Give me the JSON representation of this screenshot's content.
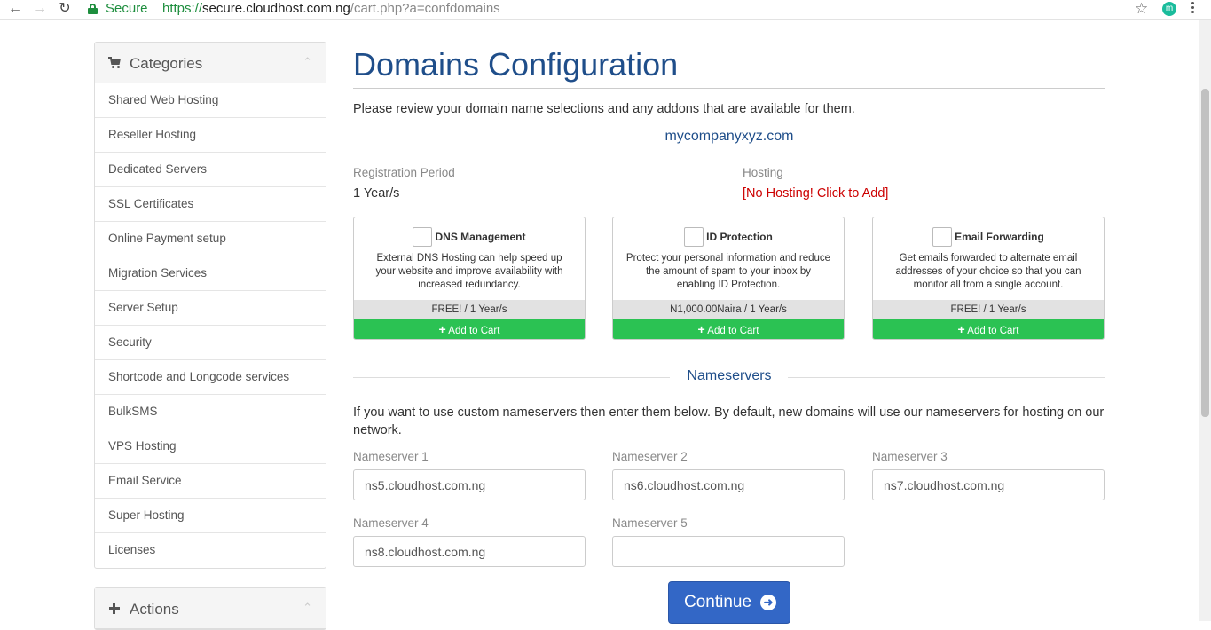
{
  "browser": {
    "secure_label": "Secure",
    "url_protocol": "https://",
    "url_host": "secure.cloudhost.com.ng",
    "url_path": "/cart.php?a=confdomains",
    "profile_initial": "m"
  },
  "sidebar": {
    "categories_title": "Categories",
    "items": [
      {
        "label": "Shared Web Hosting"
      },
      {
        "label": "Reseller Hosting"
      },
      {
        "label": "Dedicated Servers"
      },
      {
        "label": "SSL Certificates"
      },
      {
        "label": "Online Payment setup"
      },
      {
        "label": "Migration Services"
      },
      {
        "label": "Server Setup"
      },
      {
        "label": "Security"
      },
      {
        "label": "Shortcode and Longcode services"
      },
      {
        "label": "BulkSMS"
      },
      {
        "label": "VPS Hosting"
      },
      {
        "label": "Email Service"
      },
      {
        "label": "Super Hosting"
      },
      {
        "label": "Licenses"
      }
    ],
    "actions_title": "Actions"
  },
  "main": {
    "title": "Domains Configuration",
    "intro": "Please review your domain name selections and any addons that are available for them.",
    "domain": "mycompanyxyz.com",
    "registration_period_label": "Registration Period",
    "registration_period_value": "1 Year/s",
    "hosting_label": "Hosting",
    "hosting_value": "[No Hosting! Click to Add]",
    "addons": [
      {
        "title": "DNS Management",
        "description": "External DNS Hosting can help speed up your website and improve availability with increased redundancy.",
        "price": "FREE! / 1 Year/s",
        "button": "Add to Cart"
      },
      {
        "title": "ID Protection",
        "description": "Protect your personal information and reduce the amount of spam to your inbox by enabling ID Protection.",
        "price": "N1,000.00Naira / 1 Year/s",
        "button": "Add to Cart"
      },
      {
        "title": "Email Forwarding",
        "description": "Get emails forwarded to alternate email addresses of your choice so that you can monitor all from a single account.",
        "price": "FREE! / 1 Year/s",
        "button": "Add to Cart"
      }
    ],
    "nameservers_title": "Nameservers",
    "nameservers_intro": "If you want to use custom nameservers then enter them below. By default, new domains will use our nameservers for hosting on our network.",
    "nameservers": [
      {
        "label": "Nameserver 1",
        "value": "ns5.cloudhost.com.ng"
      },
      {
        "label": "Nameserver 2",
        "value": "ns6.cloudhost.com.ng"
      },
      {
        "label": "Nameserver 3",
        "value": "ns7.cloudhost.com.ng"
      },
      {
        "label": "Nameserver 4",
        "value": "ns8.cloudhost.com.ng"
      },
      {
        "label": "Nameserver 5",
        "value": ""
      }
    ],
    "continue_label": "Continue"
  }
}
